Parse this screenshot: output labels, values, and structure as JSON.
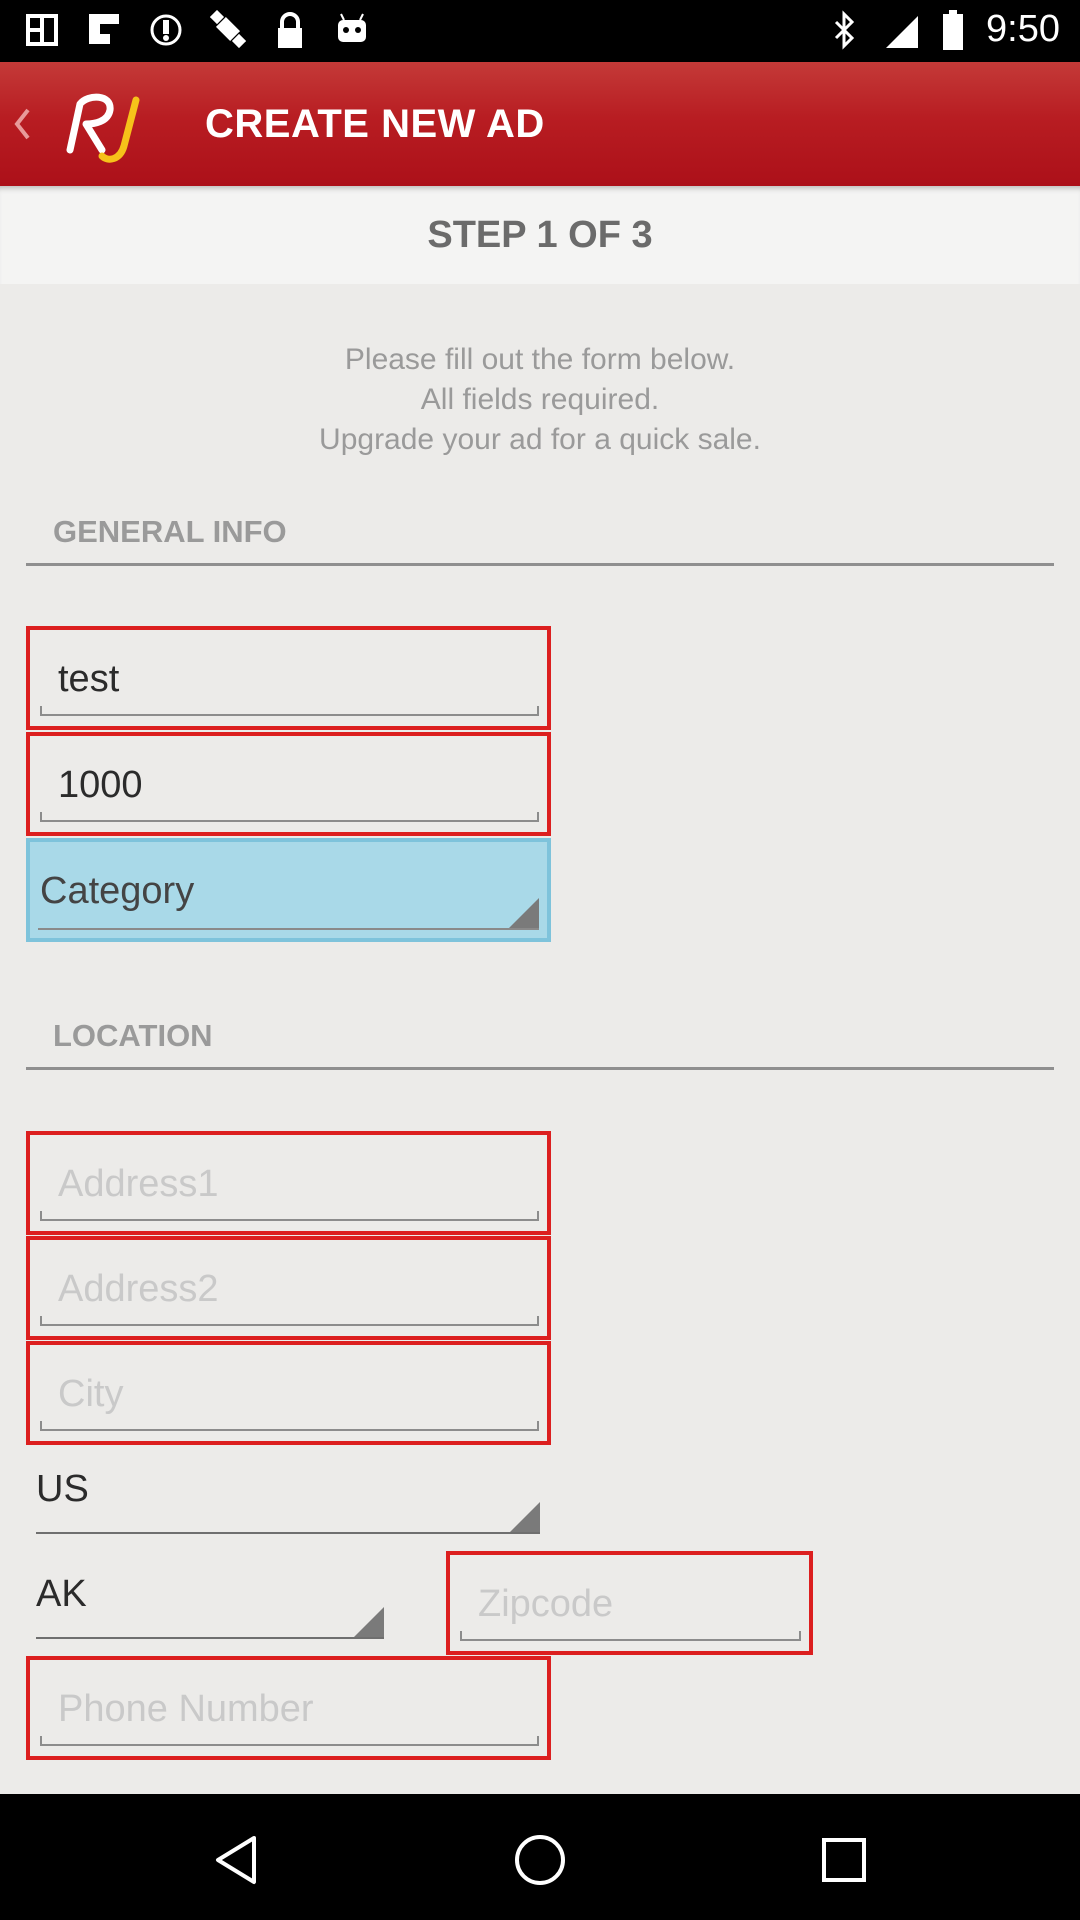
{
  "status_bar": {
    "time": "9:50",
    "left_icons": [
      "photo-icon",
      "flipboard-icon",
      "sync-icon",
      "satellite-icon",
      "lock-icon",
      "android-icon"
    ],
    "right_icons": [
      "bluetooth-icon",
      "signal-icon",
      "battery-icon"
    ]
  },
  "app_bar": {
    "title": "CREATE NEW AD",
    "logo_text": "RJ",
    "back_icon": "chevron-left-icon"
  },
  "step": {
    "label": "STEP 1 OF 3"
  },
  "intro": {
    "line1": "Please fill out the form below.",
    "line2": "All fields required.",
    "line3": "Upgrade your ad for a quick sale."
  },
  "general_info": {
    "header": "GENERAL INFO",
    "title_value": "test",
    "price_value": "1000",
    "category_label": "Category"
  },
  "location": {
    "header": "LOCATION",
    "address1_placeholder": "Address1",
    "address2_placeholder": "Address2",
    "city_placeholder": "City",
    "country_value": "US",
    "state_value": "AK",
    "zipcode_placeholder": "Zipcode",
    "phone_placeholder": "Phone Number"
  },
  "nav_bar": {
    "buttons": [
      "back-triangle-icon",
      "home-circle-icon",
      "recents-square-icon"
    ]
  },
  "colors": {
    "app_bar": "#b81d22",
    "error_border": "#dc1f1f",
    "category_fill": "#a9d9e8",
    "background": "#ecebe9"
  }
}
